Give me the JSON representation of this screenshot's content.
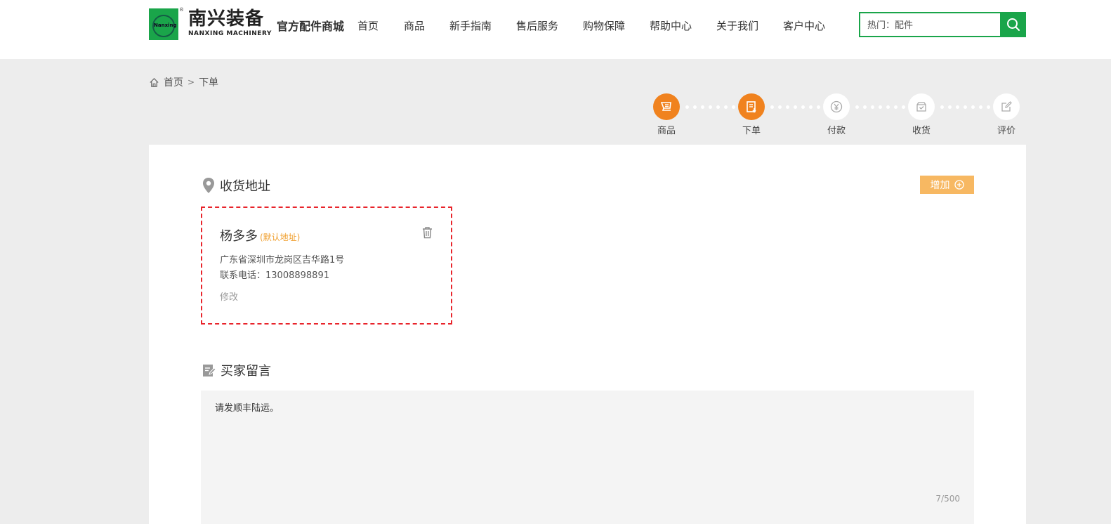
{
  "brand": {
    "mark_text": "Nanxing",
    "name_cn": "南兴装备",
    "name_en": "NANXING MACHINERY",
    "reg_mark": "®",
    "mall_title": "官方配件商城",
    "color": "#1aa54a"
  },
  "nav": {
    "items": [
      {
        "label": "首页"
      },
      {
        "label": "商品"
      },
      {
        "label": "新手指南"
      },
      {
        "label": "售后服务"
      },
      {
        "label": "购物保障"
      },
      {
        "label": "帮助中心"
      },
      {
        "label": "关于我们"
      },
      {
        "label": "客户中心"
      }
    ]
  },
  "search": {
    "placeholder": "热门：配件",
    "icon": "search-icon"
  },
  "breadcrumb": {
    "home_icon": "home-icon",
    "home": "首页",
    "sep": ">",
    "current": "下单"
  },
  "steps": {
    "active_color": "#f0821e",
    "items": [
      {
        "label": "商品",
        "icon": "cart-icon",
        "active": true
      },
      {
        "label": "下单",
        "icon": "order-icon",
        "active": true
      },
      {
        "label": "付款",
        "icon": "yen-icon",
        "active": false
      },
      {
        "label": "收货",
        "icon": "box-icon",
        "active": false
      },
      {
        "label": "评价",
        "icon": "edit-icon",
        "active": false
      }
    ]
  },
  "address_section": {
    "title": "收货地址",
    "icon": "location-pin-icon",
    "add_label": "增加",
    "add_icon": "plus-circle-icon",
    "address": {
      "name": "杨多多",
      "tag": "(默认地址)",
      "line": "广东省深圳市龙岗区吉华路1号",
      "phone_label": "联系电话：",
      "phone": "13008898891",
      "edit_label": "修改",
      "delete_icon": "trash-icon"
    }
  },
  "message_section": {
    "title": "买家留言",
    "icon": "note-icon",
    "value": "请发顺丰陆运。",
    "count": "7/500"
  }
}
